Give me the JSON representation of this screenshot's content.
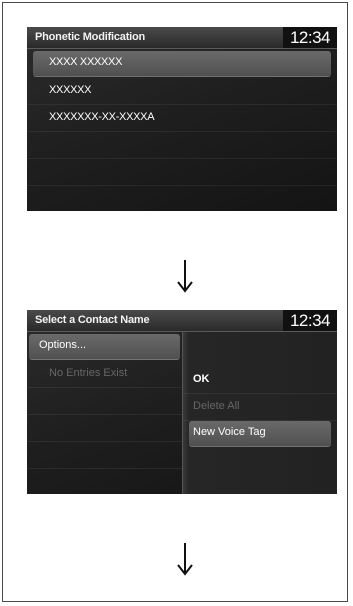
{
  "screen1": {
    "title": "Phonetic Modification",
    "clock": "12:34",
    "items": [
      {
        "label": "XXXX XXXXXX"
      },
      {
        "label": "XXXXXX"
      },
      {
        "label": "XXXXXXX-XX-XXXXA"
      }
    ]
  },
  "screen2": {
    "title": "Select a Contact Name",
    "clock": "12:34",
    "left_items": [
      {
        "label": "Options..."
      },
      {
        "label": "No Entries Exist"
      }
    ],
    "menu_items": [
      {
        "label": "OK"
      },
      {
        "label": "Delete All"
      },
      {
        "label": "New Voice Tag"
      }
    ]
  },
  "icons": [
    "arrow-down-icon",
    "arrow-down-icon"
  ]
}
